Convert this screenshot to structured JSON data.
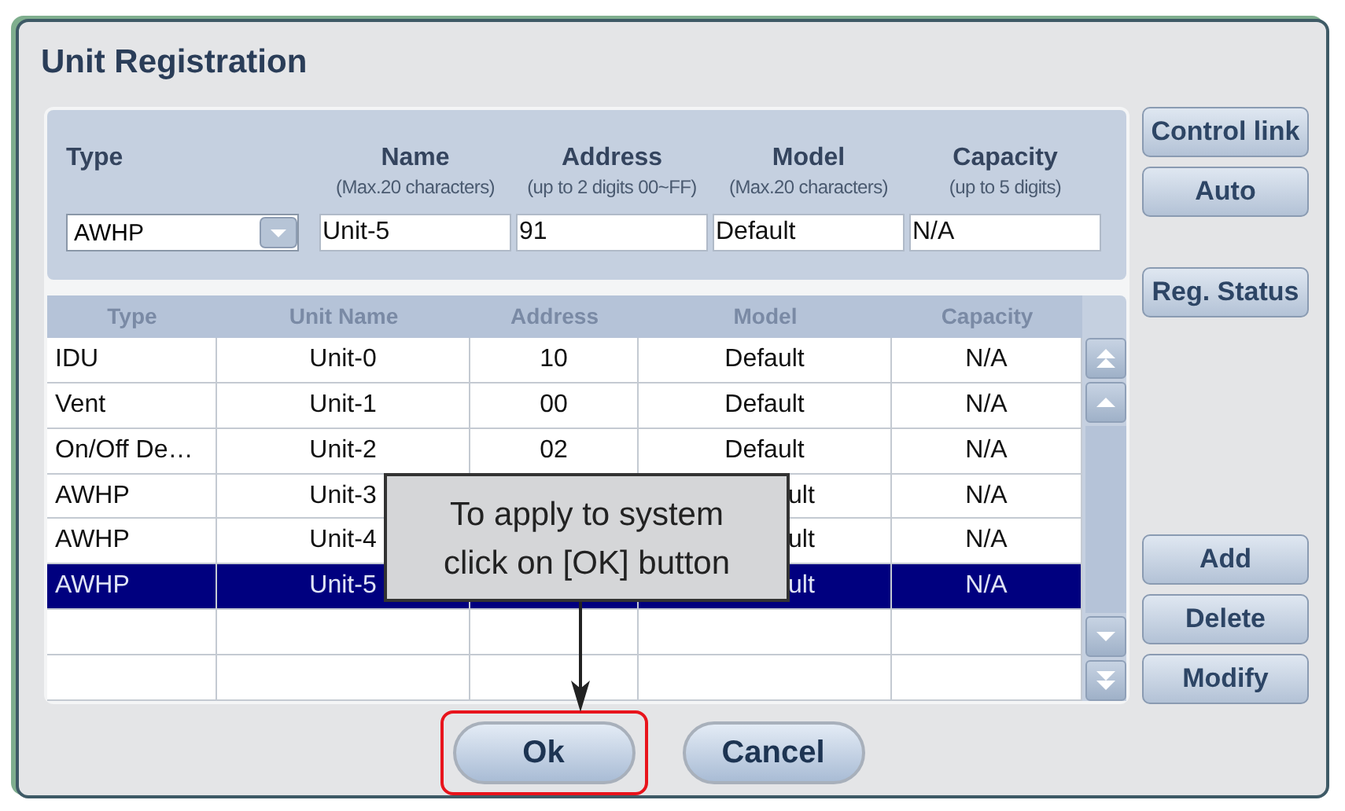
{
  "window": {
    "title": "Unit Registration"
  },
  "form": {
    "fields": [
      {
        "kind": "select",
        "label": "Type",
        "value": "AWHP"
      },
      {
        "kind": "text",
        "label": "Name",
        "hint": "(Max.20 characters)",
        "value": "Unit-5"
      },
      {
        "kind": "text",
        "label": "Address",
        "hint": "(up to 2 digits 00~FF)",
        "value": "91"
      },
      {
        "kind": "text",
        "label": "Model",
        "hint": "(Max.20 characters)",
        "value": "Default"
      },
      {
        "kind": "text",
        "label": "Capacity",
        "hint": "(up to 5 digits)",
        "value": "N/A"
      }
    ]
  },
  "side_buttons": [
    "Control link",
    "Auto"
  ],
  "status_button": "Reg. Status",
  "table": {
    "columns": [
      "Type",
      "Unit Name",
      "Address",
      "Model",
      "Capacity"
    ],
    "rows": [
      {
        "type": "IDU",
        "name": "Unit-0",
        "address": "10",
        "model": "Default",
        "capacity": "N/A",
        "covered": false,
        "selected": false
      },
      {
        "type": "Vent",
        "name": "Unit-1",
        "address": "00",
        "model": "Default",
        "capacity": "N/A",
        "covered": false,
        "selected": false
      },
      {
        "type": "On/Off De…",
        "name": "Unit-2",
        "address": "02",
        "model": "Default",
        "capacity": "N/A",
        "covered": false,
        "selected": false
      },
      {
        "type": "AWHP",
        "name": "Unit-3",
        "model": "ult",
        "capacity": "N/A",
        "covered": true,
        "selected": false
      },
      {
        "type": "AWHP",
        "name": "Unit-4",
        "model": "ult",
        "capacity": "N/A",
        "covered": true,
        "selected": false
      },
      {
        "type": "AWHP",
        "name": "Unit-5",
        "model": "ult",
        "capacity": "N/A",
        "covered": true,
        "selected": true
      }
    ]
  },
  "action_buttons": [
    "Add",
    "Delete",
    "Modify"
  ],
  "dialog_buttons": [
    {
      "label": "Ok",
      "highlighted": true
    },
    {
      "label": "Cancel",
      "highlighted": false
    }
  ],
  "callout": {
    "text": "To apply to system\nclick on [OK] button"
  }
}
